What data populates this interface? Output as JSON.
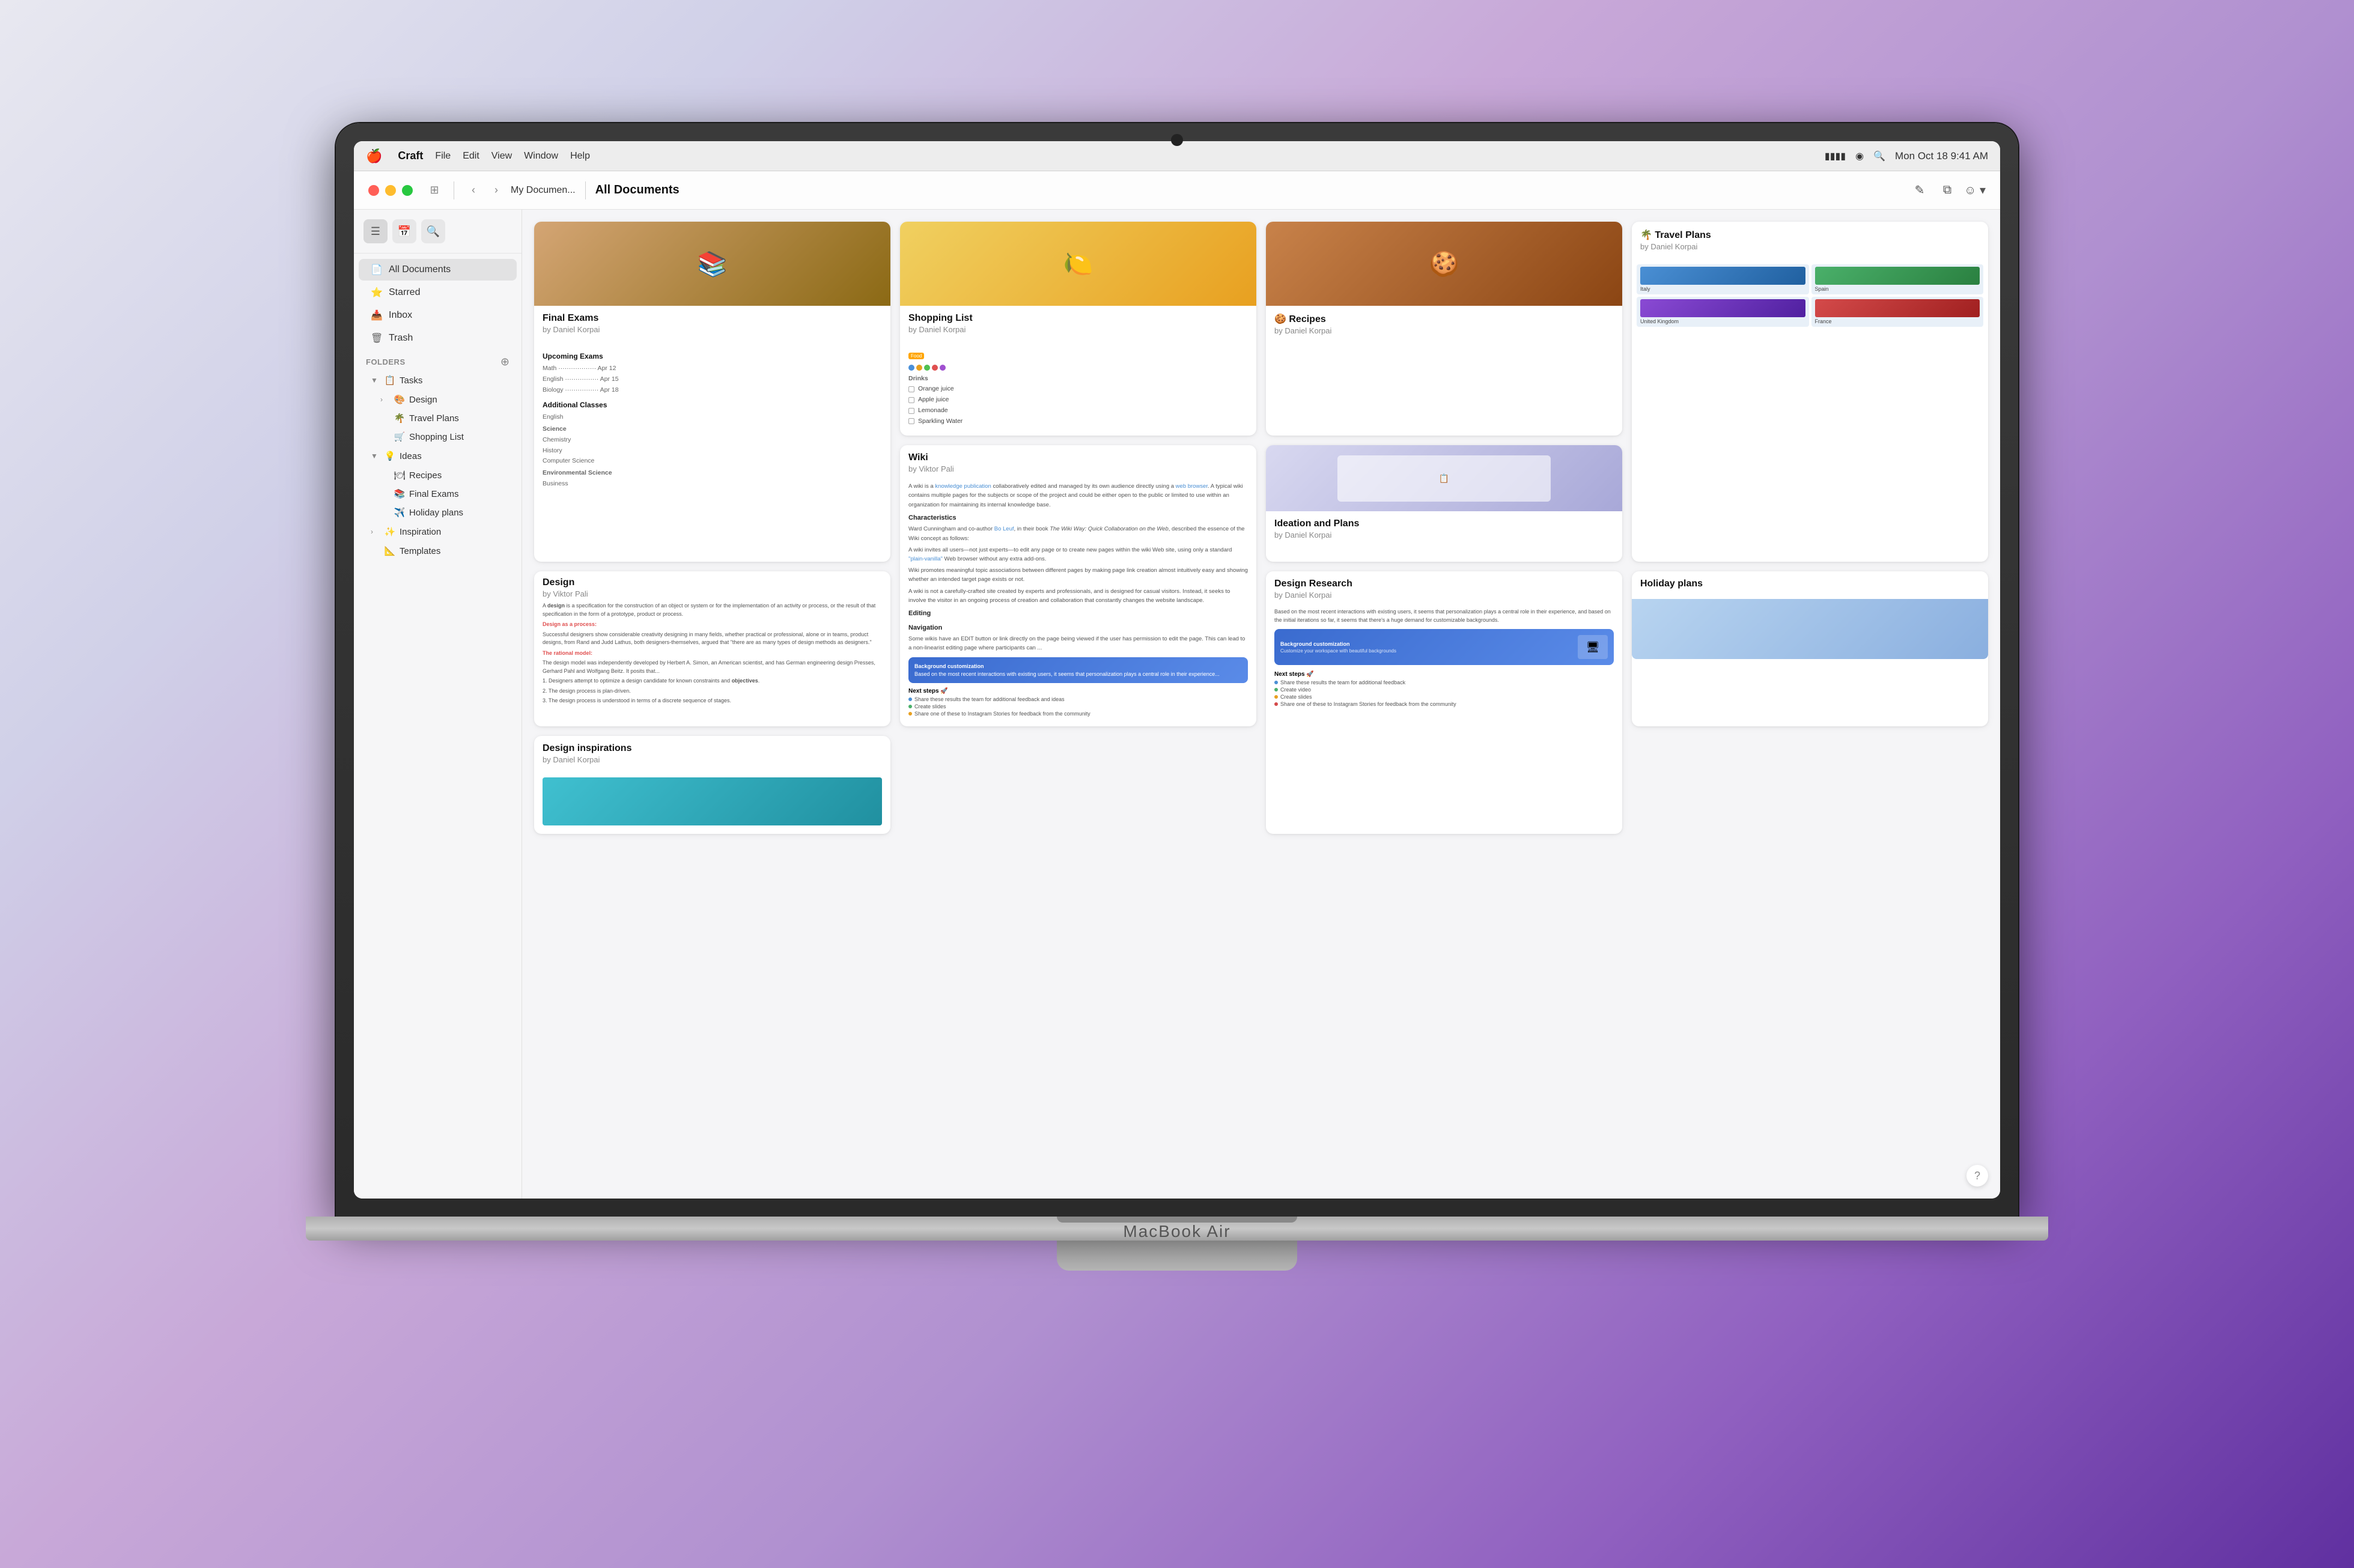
{
  "macbook": {
    "label": "MacBook Air"
  },
  "menubar": {
    "apple": "🍎",
    "app_name": "Craft",
    "items": [
      "File",
      "Edit",
      "View",
      "Window",
      "Help"
    ],
    "time": "Mon Oct 18  9:41 AM",
    "battery": "🔋",
    "wifi": "📶"
  },
  "titlebar": {
    "title": "All Documents",
    "app_name": "My Documen...",
    "back_btn": "‹",
    "fwd_btn": "›",
    "sidebar_icon": "⊞",
    "edit_icon": "✎",
    "copy_icon": "⧉",
    "share_icon": "☺"
  },
  "sidebar": {
    "nav": {
      "list_icon": "☰",
      "calendar_icon": "📅",
      "search_icon": "🔍"
    },
    "items": [
      {
        "icon": "📄",
        "label": "All Documents",
        "active": true
      },
      {
        "icon": "⭐",
        "label": "Starred"
      },
      {
        "icon": "📥",
        "label": "Inbox"
      },
      {
        "icon": "🗑",
        "label": "Trash"
      }
    ],
    "folders_section": "Folders",
    "folders": [
      {
        "label": "Tasks",
        "icon": "📋",
        "expanded": true,
        "children": [
          {
            "label": "Design",
            "icon": "🎨",
            "expanded": false
          },
          {
            "label": "Travel Plans",
            "icon": "🌴",
            "expanded": false
          },
          {
            "label": "Shopping List",
            "icon": "🛒",
            "expanded": false
          }
        ]
      },
      {
        "label": "Ideas",
        "icon": "💡",
        "expanded": true,
        "children": [
          {
            "label": "Recipes",
            "icon": "🍽",
            "expanded": false
          },
          {
            "label": "Final Exams",
            "icon": "📚",
            "expanded": false
          },
          {
            "label": "Holiday plans",
            "icon": "✈️",
            "expanded": false
          }
        ]
      },
      {
        "label": "Inspiration",
        "icon": "✨",
        "expanded": false
      },
      {
        "label": "Templates",
        "icon": "📐",
        "expanded": false
      }
    ]
  },
  "documents": [
    {
      "id": "final-exams",
      "title": "Final Exams",
      "author": "by Daniel Korpai",
      "type": "books",
      "tall": true
    },
    {
      "id": "shopping-list",
      "title": "Shopping List",
      "author": "by Daniel Korpai",
      "type": "lemons",
      "tall": false
    },
    {
      "id": "recipes",
      "title": "🍪 Recipes",
      "author": "by Daniel Korpai",
      "type": "cookies",
      "tall": false
    },
    {
      "id": "travel-plans",
      "title": "🌴 Travel Plans",
      "author": "by Daniel Korpai",
      "type": "travel-grid",
      "tall": true
    },
    {
      "id": "wiki",
      "title": "Wiki",
      "author": "by Viktor Pali",
      "type": "wiki",
      "tall": true
    },
    {
      "id": "ideation",
      "title": "Ideation and Plans",
      "author": "by Daniel Korpai",
      "type": "ideation",
      "tall": false
    },
    {
      "id": "design",
      "title": "Design",
      "author": "by Viktor Pali",
      "type": "design",
      "tall": false
    },
    {
      "id": "design-research",
      "title": "Design Research",
      "author": "by Daniel Korpai",
      "type": "design-research",
      "tall": true
    },
    {
      "id": "holiday-plans",
      "title": "Holiday plans",
      "author": "",
      "type": "holiday",
      "tall": false
    },
    {
      "id": "design-inspirations",
      "title": "Design inspirations",
      "author": "by Daniel Korpai",
      "type": "inspirations",
      "tall": false
    }
  ]
}
